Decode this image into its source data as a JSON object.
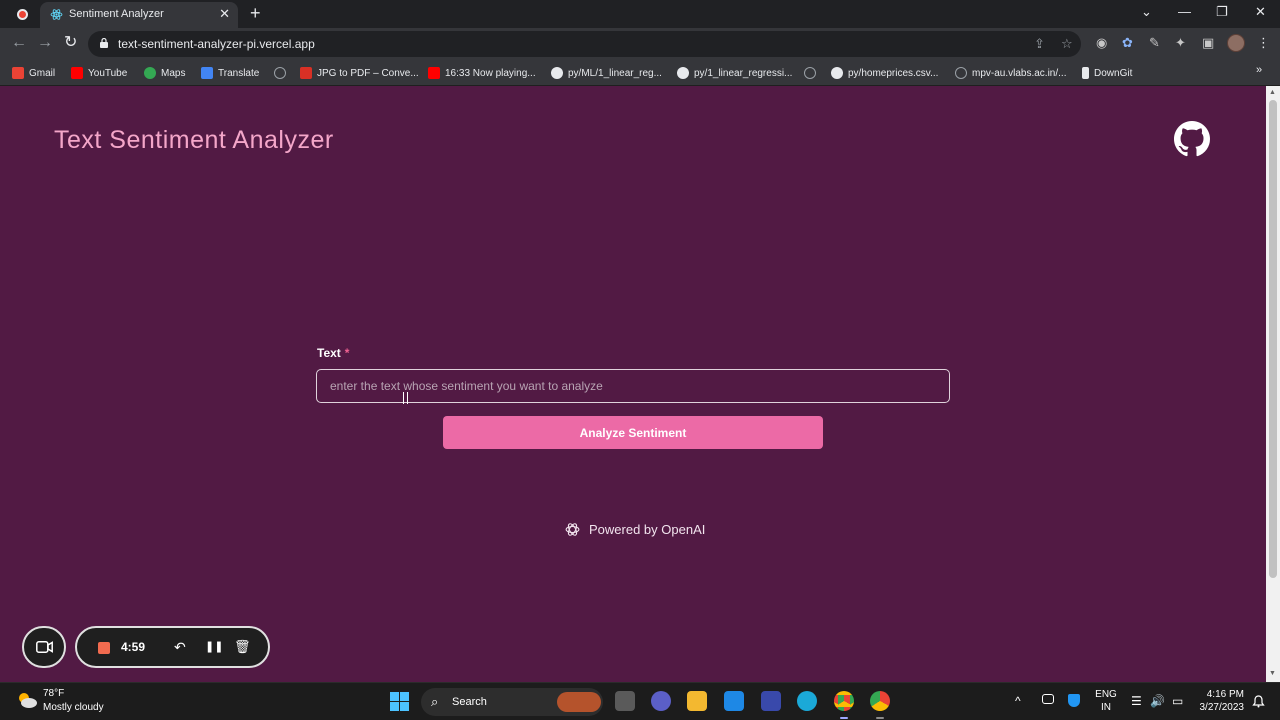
{
  "browser": {
    "tab": {
      "title": "Sentiment Analyzer",
      "close_glyph": "✕"
    },
    "new_tab_glyph": "+",
    "window_controls": {
      "dropdown": "⌄",
      "minimize": "—",
      "maximize": "❐",
      "close": "✕"
    },
    "nav": {
      "back": "←",
      "forward": "→",
      "reload": "↻"
    },
    "url": "text-sentiment-analyzer-pi.vercel.app",
    "omnibox_icons": {
      "share": "⇪",
      "star": "☆"
    },
    "extension_icons": [
      "◉",
      "✿",
      "✎",
      "✦",
      "▣"
    ],
    "menu_glyph": "⋮",
    "bookmarks": [
      {
        "label": "Gmail",
        "icon": "gmail-icon",
        "color": "#ea4335"
      },
      {
        "label": "YouTube",
        "icon": "youtube-icon",
        "color": "#ff0000"
      },
      {
        "label": "Maps",
        "icon": "maps-icon",
        "color": "#34a853"
      },
      {
        "label": "Translate",
        "icon": "translate-icon",
        "color": "#4285f4"
      },
      {
        "label": "",
        "icon": "globe-icon",
        "color": "#9aa0a6"
      },
      {
        "label": "JPG to PDF – Conve...",
        "icon": "pdf-icon",
        "color": "#d93025"
      },
      {
        "label": "16:33 Now playing...",
        "icon": "youtube-icon",
        "color": "#ff0000"
      },
      {
        "label": "py/ML/1_linear_reg...",
        "icon": "github-icon",
        "color": "#e8eaed"
      },
      {
        "label": "py/1_linear_regressi...",
        "icon": "github-icon",
        "color": "#e8eaed"
      },
      {
        "label": "",
        "icon": "globe-icon",
        "color": "#9aa0a6"
      },
      {
        "label": "py/homeprices.csv...",
        "icon": "github-icon",
        "color": "#e8eaed"
      },
      {
        "label": "mpv-au.vlabs.ac.in/...",
        "icon": "globe-icon",
        "color": "#9aa0a6"
      },
      {
        "label": "DownGit",
        "icon": "download-icon",
        "color": "#e8eaed"
      }
    ],
    "bookmarks_more": "»"
  },
  "page": {
    "title": "Text Sentiment Analyzer",
    "form": {
      "label": "Text",
      "required_mark": "*",
      "placeholder": "enter the text whose sentiment you want to analyze",
      "value": ""
    },
    "submit_label": "Analyze Sentiment",
    "footer": "Powered by OpenAI",
    "colors": {
      "background": "#521a44",
      "title": "#f4a6c9",
      "button": "#ec6aa6"
    }
  },
  "recorder": {
    "time": "4:59",
    "undo_glyph": "↶",
    "pause_glyph": "❚❚",
    "delete_glyph": "🗑"
  },
  "taskbar": {
    "weather": {
      "temp": "78°F",
      "desc": "Mostly cloudy"
    },
    "search_label": "Search",
    "search_glyph": "⌕",
    "tray_glyphs": {
      "chevron": "^",
      "wifi": "☰",
      "volume": "🔊",
      "battery": "▭"
    },
    "lang": {
      "line1": "ENG",
      "line2": "IN"
    },
    "clock": {
      "time": "4:16 PM",
      "date": "3/27/2023"
    }
  }
}
